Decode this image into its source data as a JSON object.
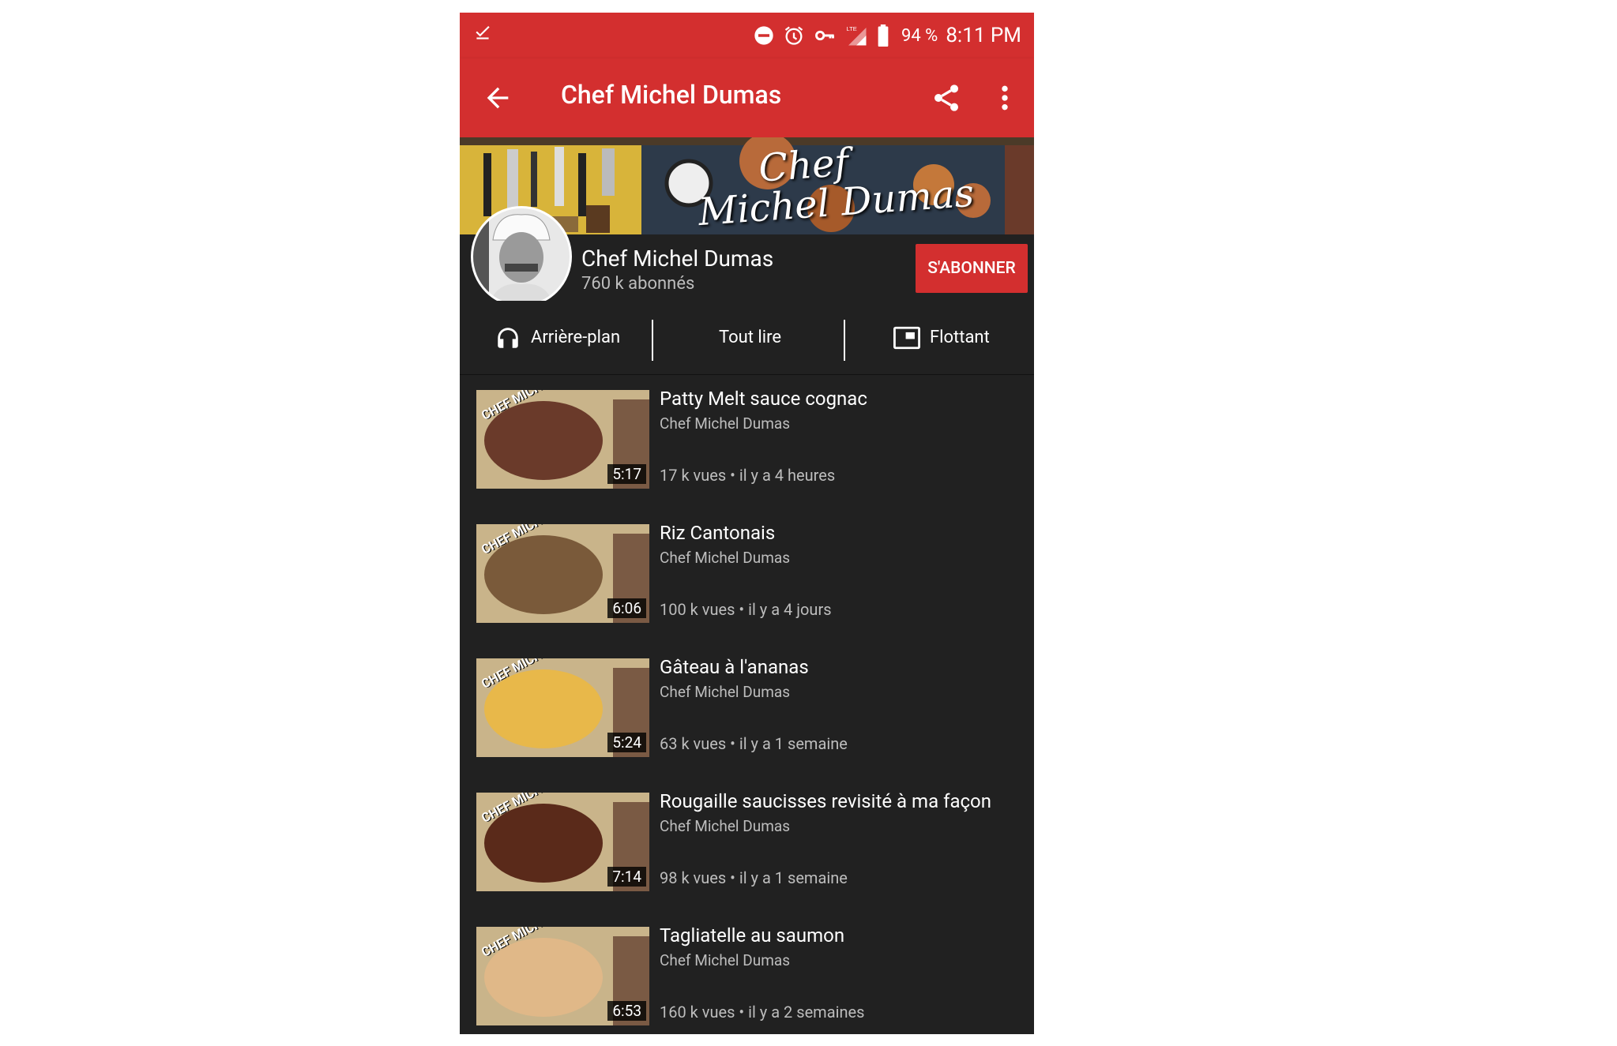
{
  "status_bar": {
    "battery_percent": "94 %",
    "time": "8:11 PM",
    "network": "LTE"
  },
  "app_bar": {
    "title": "Chef Michel Dumas"
  },
  "banner": {
    "line1": "Chef",
    "line2": "Michel Dumas"
  },
  "channel": {
    "name": "Chef Michel Dumas",
    "subscribers": "760 k abonnés",
    "subscribe_label": "S'ABONNER"
  },
  "actions": {
    "background": "Arrière-plan",
    "play_all": "Tout lire",
    "floating": "Flottant"
  },
  "thumbnail_tag": "CHEF MICHEL",
  "videos": [
    {
      "title": "Patty Melt sauce cognac",
      "channel": "Chef Michel Dumas",
      "meta": "17 k vues • il y a 4 heures",
      "duration": "5:17"
    },
    {
      "title": "Riz Cantonais",
      "channel": "Chef Michel Dumas",
      "meta": "100 k vues • il y a 4 jours",
      "duration": "6:06"
    },
    {
      "title": "Gâteau à l'ananas",
      "channel": "Chef Michel Dumas",
      "meta": "63 k vues • il y a 1 semaine",
      "duration": "5:24"
    },
    {
      "title": "Rougaille saucisses revisité à ma façon",
      "channel": "Chef Michel Dumas",
      "meta": "98 k vues • il y a 1 semaine",
      "duration": "7:14"
    },
    {
      "title": "Tagliatelle au saumon",
      "channel": "Chef Michel Dumas",
      "meta": "160 k vues • il y a 2 semaines",
      "duration": "6:53"
    }
  ],
  "colors": {
    "accent": "#d32f2f",
    "background": "#212121",
    "text_secondary": "#bdbdbd"
  }
}
